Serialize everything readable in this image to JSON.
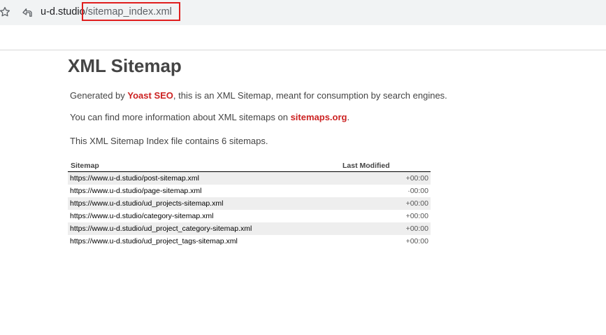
{
  "browser": {
    "url_host": "u-d.studio",
    "url_path": "/sitemap_index.xml"
  },
  "page": {
    "title": "XML Sitemap",
    "intro": {
      "prefix": "Generated by ",
      "link": "Yoast SEO",
      "suffix": ", this is an XML Sitemap, meant for consumption by search engines."
    },
    "info": {
      "prefix": "You can find more information about XML sitemaps on ",
      "link": "sitemaps.org",
      "suffix": "."
    },
    "count_text": "This XML Sitemap Index file contains 6 sitemaps."
  },
  "table": {
    "headers": {
      "sitemap": "Sitemap",
      "last_modified": "Last Modified"
    },
    "rows": [
      {
        "url": "https://www.u-d.studio/post-sitemap.xml",
        "modified": "+00:00"
      },
      {
        "url": "https://www.u-d.studio/page-sitemap.xml",
        "modified": "·00:00"
      },
      {
        "url": "https://www.u-d.studio/ud_projects-sitemap.xml",
        "modified": "+00:00"
      },
      {
        "url": "https://www.u-d.studio/category-sitemap.xml",
        "modified": "+00:00"
      },
      {
        "url": "https://www.u-d.studio/ud_project_category-sitemap.xml",
        "modified": "+00:00"
      },
      {
        "url": "https://www.u-d.studio/ud_project_tags-sitemap.xml",
        "modified": "+00:00"
      }
    ]
  },
  "colors": {
    "link_accent": "#cc2222",
    "highlight_box": "#e01e1e",
    "row_stripe": "#eeeeee"
  },
  "icons": [
    "star-icon",
    "site-settings-icon"
  ]
}
